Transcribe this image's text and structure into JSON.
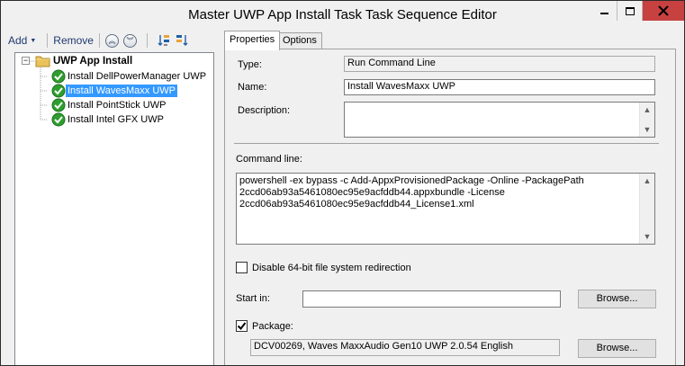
{
  "window": {
    "title": "Master UWP App Install Task Task Sequence Editor"
  },
  "toolbar": {
    "add_label": "Add",
    "remove_label": "Remove"
  },
  "tree": {
    "root": "UWP App Install",
    "items": [
      {
        "label": "Install DellPowerManager UWP",
        "selected": false
      },
      {
        "label": "Install WavesMaxx UWP",
        "selected": true
      },
      {
        "label": "Install PointStick UWP",
        "selected": false
      },
      {
        "label": "Install Intel GFX UWP",
        "selected": false
      }
    ]
  },
  "tabs": [
    {
      "label": "Properties",
      "active": true
    },
    {
      "label": "Options",
      "active": false
    }
  ],
  "properties": {
    "type_label": "Type:",
    "type_value": "Run Command Line",
    "name_label": "Name:",
    "name_value": "Install WavesMaxx UWP",
    "description_label": "Description:",
    "description_value": "",
    "command_line_label": "Command line:",
    "command_line_lines": [
      "powershell -ex bypass -c Add-AppxProvisionedPackage -Online -PackagePath",
      "2ccd06ab93a5461080ec95e9acfddb44.appxbundle -License",
      "2ccd06ab93a5461080ec95e9acfddb44_License1.xml"
    ],
    "disable_redirection_label": "Disable 64-bit file system redirection",
    "disable_redirection_checked": false,
    "start_in_label": "Start in:",
    "start_in_value": "",
    "browse_label": "Browse...",
    "package_label": "Package:",
    "package_checked": true,
    "package_value": "DCV00269, Waves MaxxAudio Gen10 UWP 2.0.54 English"
  },
  "colors": {
    "selection": "#3399ff",
    "close_button": "#c74141",
    "check_green": "#2e9e2e"
  }
}
